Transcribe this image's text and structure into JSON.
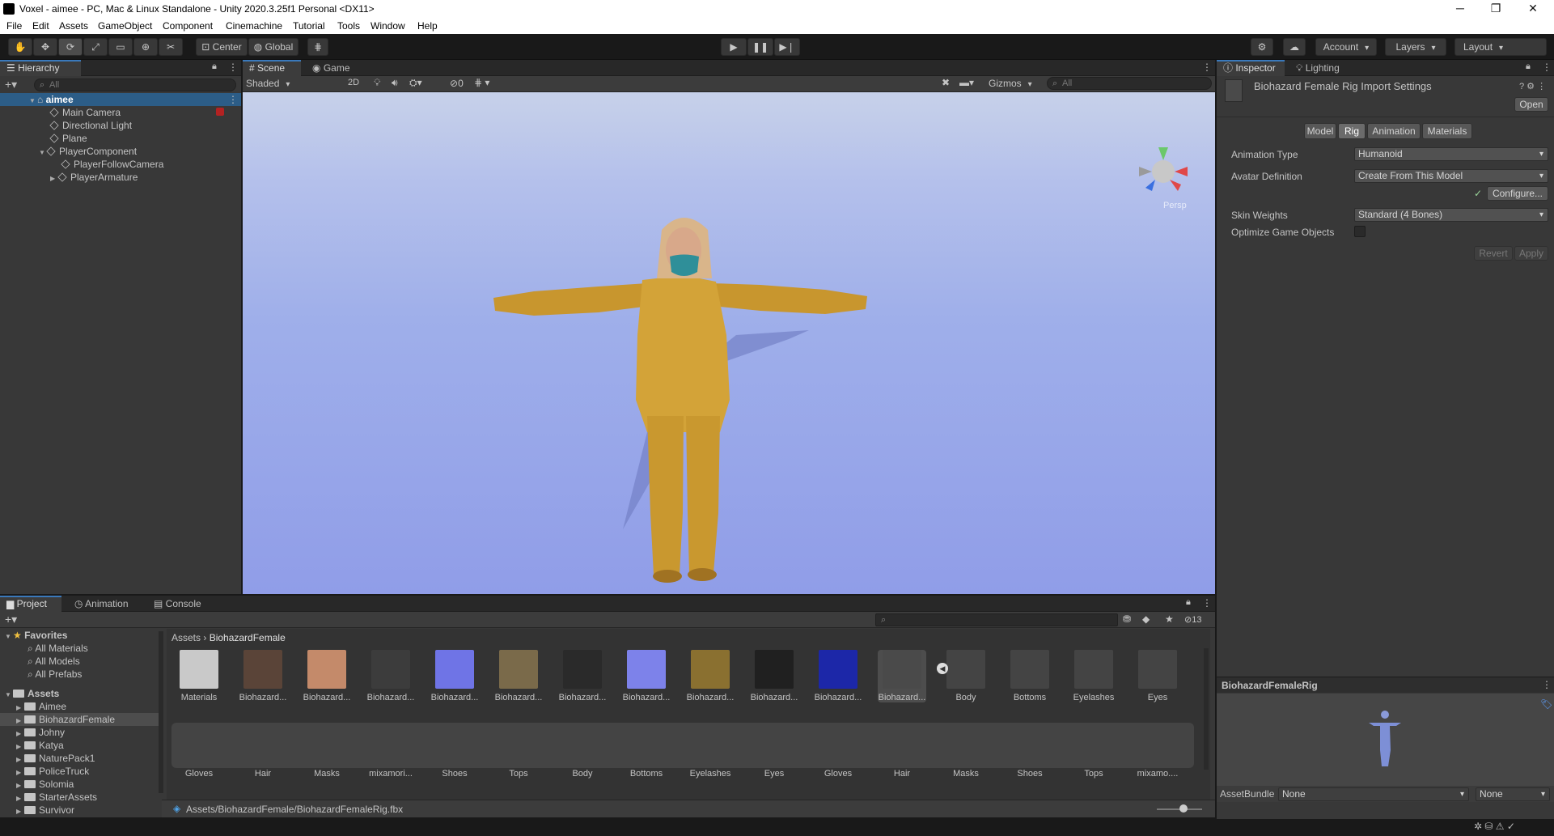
{
  "window": {
    "title": "Voxel - aimee - PC, Mac & Linux Standalone - Unity 2020.3.25f1 Personal <DX11>",
    "minimize": "─",
    "maximize": "❐",
    "close": "✕"
  },
  "menu": [
    "File",
    "Edit",
    "Assets",
    "GameObject",
    "Component",
    "Cinemachine",
    "Tutorial",
    "Tools",
    "Window",
    "Help"
  ],
  "toolbar": {
    "pivot": "Center",
    "space": "Global",
    "account": "Account",
    "layers": "Layers",
    "layout": "Layout"
  },
  "hierarchy": {
    "tab": "Hierarchy",
    "search_placeholder": "All",
    "scene": "aimee",
    "items": [
      "Main Camera",
      "Directional Light",
      "Plane",
      "PlayerComponent",
      "PlayerFollowCamera",
      "PlayerArmature"
    ]
  },
  "scene_view": {
    "tabs": [
      "Scene",
      "Game"
    ],
    "draw_mode": "Shaded",
    "mode_2d": "2D",
    "hidden_count": "0",
    "gizmos": "Gizmos",
    "search_placeholder": "All",
    "projection": "Persp",
    "colors": {
      "sky_top": "#c7d1ea",
      "sky_bottom": "#8ea0ea",
      "ground": "#909de8",
      "suit": "#d3a338",
      "mask": "#2f8f99"
    }
  },
  "inspector": {
    "tabs": [
      "Inspector",
      "Lighting"
    ],
    "title": "Biohazard Female Rig Import Settings",
    "open": "Open",
    "subtabs": [
      "Model",
      "Rig",
      "Animation",
      "Materials"
    ],
    "active_subtab": "Rig",
    "fields": {
      "animation_type_label": "Animation Type",
      "animation_type_value": "Humanoid",
      "avatar_def_label": "Avatar Definition",
      "avatar_def_value": "Create From This Model",
      "configure": "Configure...",
      "configure_check": "✓",
      "skin_weights_label": "Skin Weights",
      "skin_weights_value": "Standard (4 Bones)",
      "optimize_label": "Optimize Game Objects"
    },
    "revert": "Revert",
    "apply": "Apply",
    "preview_title": "BiohazardFemaleRig",
    "asset_bundle_label": "AssetBundle",
    "asset_bundle_value": "None",
    "asset_bundle_variant": "None"
  },
  "project": {
    "tabs": [
      "Project",
      "Animation",
      "Console"
    ],
    "hidden_count": "13",
    "favorites": "Favorites",
    "favorite_items": [
      "All Materials",
      "All Models",
      "All Prefabs"
    ],
    "assets_root": "Assets",
    "folders": [
      "Aimee",
      "BiohazardFemale",
      "Johny",
      "Katya",
      "NaturePack1",
      "PoliceTruck",
      "Solomia",
      "StarterAssets",
      "Survivor"
    ],
    "breadcrumb": [
      "Assets",
      "BiohazardFemale"
    ],
    "row1": [
      {
        "name": "Materials",
        "color": "#c9c9c9"
      },
      {
        "name": "Biohazard...",
        "color": "#5a4438"
      },
      {
        "name": "Biohazard...",
        "color": "#c48a6a"
      },
      {
        "name": "Biohazard...",
        "color": "#3c3c3c"
      },
      {
        "name": "Biohazard...",
        "color": "#6f74e6"
      },
      {
        "name": "Biohazard...",
        "color": "#7a6a4a"
      },
      {
        "name": "Biohazard...",
        "color": "#2a2a2a"
      },
      {
        "name": "Biohazard...",
        "color": "#7d82ea"
      },
      {
        "name": "Biohazard...",
        "color": "#8a7030"
      },
      {
        "name": "Biohazard...",
        "color": "#202020"
      },
      {
        "name": "Biohazard...",
        "color": "#1c27a8"
      },
      {
        "name": "Biohazard...",
        "color": "#4a4a4a"
      },
      {
        "name": "Body",
        "color": "#444"
      },
      {
        "name": "Bottoms",
        "color": "#444"
      },
      {
        "name": "Eyelashes",
        "color": "#444"
      },
      {
        "name": "Eyes",
        "color": "#444"
      }
    ],
    "row2": [
      {
        "name": "Gloves"
      },
      {
        "name": "Hair"
      },
      {
        "name": "Masks"
      },
      {
        "name": "mixamori..."
      },
      {
        "name": "Shoes"
      },
      {
        "name": "Tops"
      },
      {
        "name": "Body"
      },
      {
        "name": "Bottoms"
      },
      {
        "name": "Eyelashes"
      },
      {
        "name": "Eyes"
      },
      {
        "name": "Gloves"
      },
      {
        "name": "Hair"
      },
      {
        "name": "Masks"
      },
      {
        "name": "Shoes"
      },
      {
        "name": "Tops"
      },
      {
        "name": "mixamo...."
      }
    ],
    "selected_path": "Assets/BiohazardFemale/BiohazardFemaleRig.fbx"
  }
}
